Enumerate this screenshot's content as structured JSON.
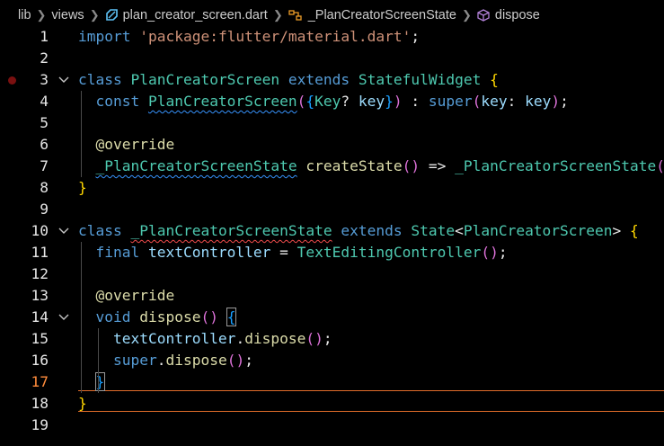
{
  "breadcrumb": {
    "items": [
      "lib",
      "views",
      "plan_creator_screen.dart",
      "_PlanCreatorScreenState",
      "dispose"
    ],
    "icons": [
      "dart-file-icon",
      "class-symbol-icon",
      "method-symbol-icon"
    ]
  },
  "editor": {
    "active_line": 17,
    "breakpoint_line": 3,
    "folded_lines": [
      3,
      10,
      14
    ],
    "line_numbers": [
      "1",
      "2",
      "3",
      "4",
      "5",
      "6",
      "7",
      "8",
      "9",
      "10",
      "11",
      "12",
      "13",
      "14",
      "15",
      "16",
      "17",
      "18",
      "19"
    ],
    "lines": [
      [
        [
          "import ",
          "k"
        ],
        [
          "'package:flutter/material.dart'",
          "s"
        ],
        [
          ";",
          "w"
        ]
      ],
      [],
      [
        [
          "class ",
          "k"
        ],
        [
          "PlanCreatorScreen ",
          "c"
        ],
        [
          "extends ",
          "k"
        ],
        [
          "StatefulWidget ",
          "c"
        ],
        [
          "{",
          "y"
        ]
      ],
      [
        [
          "  const ",
          "k"
        ],
        [
          "PlanCreatorScreen",
          "c sq-blue"
        ],
        [
          "(",
          "m"
        ],
        [
          "{",
          "b3"
        ],
        [
          "Key",
          "c"
        ],
        [
          "? ",
          "w"
        ],
        [
          "key",
          "p"
        ],
        [
          "}",
          "b3"
        ],
        [
          ")",
          "m"
        ],
        [
          " : ",
          "w"
        ],
        [
          "super",
          "k"
        ],
        [
          "(",
          "m"
        ],
        [
          "key",
          "p"
        ],
        [
          ": ",
          "w"
        ],
        [
          "key",
          "p"
        ],
        [
          ")",
          "m"
        ],
        [
          ";",
          "w"
        ]
      ],
      [],
      [
        [
          "  @override",
          "fn"
        ]
      ],
      [
        [
          "  ",
          "w"
        ],
        [
          "_PlanCreatorScreenState",
          "c sq-blue"
        ],
        [
          " ",
          "w"
        ],
        [
          "createState",
          "fn"
        ],
        [
          "()",
          "m"
        ],
        [
          " => ",
          "w"
        ],
        [
          "_PlanCreatorScreenState",
          "c"
        ],
        [
          "()",
          "m"
        ]
      ],
      [
        [
          "}",
          "y"
        ]
      ],
      [],
      [
        [
          "class ",
          "k"
        ],
        [
          "_PlanCreatorScreenState",
          "c sq-red"
        ],
        [
          " ",
          "w"
        ],
        [
          "extends ",
          "k"
        ],
        [
          "State",
          "c"
        ],
        [
          "<",
          "w"
        ],
        [
          "PlanCreatorScreen",
          "c"
        ],
        [
          "> ",
          "w"
        ],
        [
          "{",
          "y"
        ]
      ],
      [
        [
          "  final ",
          "k"
        ],
        [
          "textController",
          "p"
        ],
        [
          " = ",
          "w"
        ],
        [
          "TextEditingController",
          "c"
        ],
        [
          "()",
          "m"
        ],
        [
          ";",
          "w"
        ]
      ],
      [],
      [
        [
          "  @override",
          "fn"
        ]
      ],
      [
        [
          "  void ",
          "k"
        ],
        [
          "dispose",
          "fn"
        ],
        [
          "() ",
          "m"
        ],
        [
          "{",
          "b3 brace-box"
        ]
      ],
      [
        [
          "    textController",
          "p"
        ],
        [
          ".",
          "w"
        ],
        [
          "dispose",
          "fn"
        ],
        [
          "()",
          "m"
        ],
        [
          ";",
          "w"
        ]
      ],
      [
        [
          "    super",
          "k"
        ],
        [
          ".",
          "w"
        ],
        [
          "dispose",
          "fn"
        ],
        [
          "()",
          "m"
        ],
        [
          ";",
          "w"
        ]
      ],
      [
        [
          "  ",
          "w"
        ],
        [
          "}",
          "b3 brace-box"
        ]
      ],
      [
        [
          "}",
          "y"
        ]
      ],
      []
    ]
  }
}
